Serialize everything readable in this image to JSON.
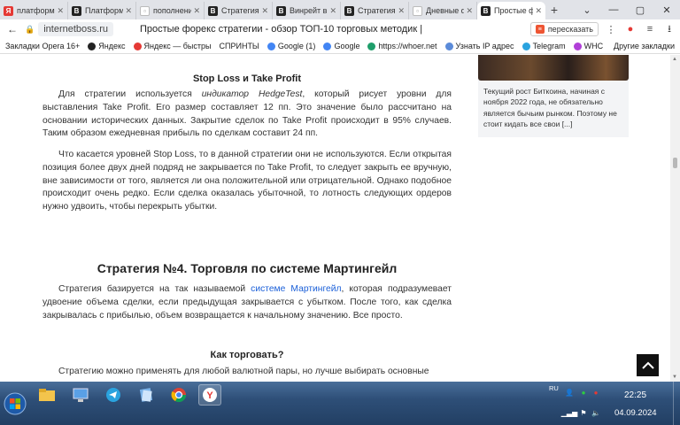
{
  "browser": {
    "tabs": [
      {
        "label": "платформы д",
        "fav_color": "#e53935",
        "fav_char": "Я"
      },
      {
        "label": "Платформы б",
        "fav_color": "#222222",
        "fav_char": "B"
      },
      {
        "label": "пополнение",
        "fav_color": "#ffffff",
        "fav_char": "▫"
      },
      {
        "label": "Стратегия М",
        "fav_color": "#222222",
        "fav_char": "B"
      },
      {
        "label": "Винрейт в тр",
        "fav_color": "#222222",
        "fav_char": "B"
      },
      {
        "label": "Стратегия С",
        "fav_color": "#222222",
        "fav_char": "B"
      },
      {
        "label": "Дневные фор",
        "fav_color": "#ffffff",
        "fav_char": "▫"
      },
      {
        "label": "Простые ф",
        "fav_color": "#222222",
        "fav_char": "B",
        "active": true
      }
    ],
    "address": {
      "domain": "internetboss.ru",
      "title": "Простые форекс стратегии - обзор ТОП-10 торговых методик |",
      "retell_label": "пересказать"
    },
    "bookmarks": [
      {
        "label": "Закладки Opera 16+",
        "color": ""
      },
      {
        "label": "Яндекс",
        "color": "#222222"
      },
      {
        "label": "Яндекс — быстры",
        "color": "#e53935"
      },
      {
        "label": "СПРИНТЫ",
        "color": ""
      },
      {
        "label": "Google (1)",
        "color": "#4285f4"
      },
      {
        "label": "Google",
        "color": "#4285f4"
      },
      {
        "label": "https://whoer.net",
        "color": "#1e9e6a"
      },
      {
        "label": "Узнать IP адрес",
        "color": "#5b8bd9"
      },
      {
        "label": "Telegram",
        "color": "#2aa3df"
      },
      {
        "label": "WHC",
        "color": "#b13fd8"
      }
    ],
    "bookmarks_other": "Другие закладки"
  },
  "article": {
    "h3_stop": "Stop Loss и Take Profit",
    "p1_before": "Для стратегии используется ",
    "p1_italic": "индикатор HedgeTest",
    "p1_after": ", который рисует уровни для выставления Take Profit. Его размер составляет 12 пп. Это значение было рассчитано на основании исторических данных. Закрытие сделок по Take Profit происходит в 95% случаев. Таким образом ежедневная прибыль по сделкам составит 24 пп.",
    "p2": "Что касается уровней Stop Loss, то в данной стратегии они не используются. Если открытая позиция более двух дней подряд не закрывается по Take Profit, то следует закрыть ее вручную, вне зависимости от того, является ли она положительной или отрицательной. Однако подобное происходит очень редко. Если сделка оказалась убыточной, то лотность следующих ордеров нужно удвоить, чтобы перекрыть убытки.",
    "h2_strategy4": "Стратегия №4. Торговля по системе Мартингейл",
    "p3_before": "Стратегия базируется на так называемой ",
    "p3_link": "системе Мартингейл",
    "p3_after": ", которая подразумевает удвоение объема сделки, если предыдущая закрывается с убытком. После того, как сделка закрывалась с прибылью, объем возвращается к начальному значению. Все просто.",
    "h3_how": "Как торговать?",
    "p4": "Стратегию можно применять для любой валютной пары, но лучше выбирать основные"
  },
  "sidebar": {
    "caption": "Текущий рост Биткоина, начиная с ноября 2022 года, не обязательно является бычьим рынком. Поэтому не стоит кидать все свои [...]"
  },
  "taskbar": {
    "lang": "RU",
    "time": "22:25",
    "date": "04.09.2024"
  }
}
